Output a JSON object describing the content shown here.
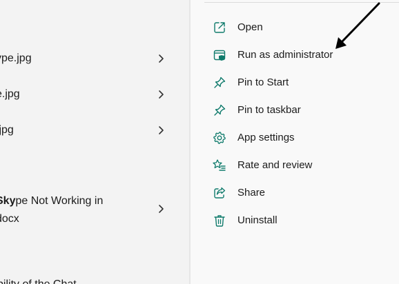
{
  "accent_color": "#0e7a6b",
  "results": [
    {
      "text_bold": "",
      "text": "ype.jpg",
      "chevron_icon": "chevron-right-icon"
    },
    {
      "text_bold": "",
      "text": "e.jpg",
      "chevron_icon": "chevron-right-icon"
    },
    {
      "text_bold": "",
      "text": ".jpg",
      "chevron_icon": "chevron-right-icon"
    },
    {
      "text_bold": "Sky",
      "text": "pe Not Working in",
      "text2": "docx",
      "chevron_icon": "chevron-right-icon"
    }
  ],
  "cut_text": "bility of the Chat",
  "context_menu": {
    "items": [
      {
        "label": "Open",
        "icon": "open-icon"
      },
      {
        "label": "Run as administrator",
        "icon": "run-as-admin-icon"
      },
      {
        "label": "Pin to Start",
        "icon": "pin-icon"
      },
      {
        "label": "Pin to taskbar",
        "icon": "pin-icon"
      },
      {
        "label": "App settings",
        "icon": "gear-icon"
      },
      {
        "label": "Rate and review",
        "icon": "star-list-icon"
      },
      {
        "label": "Share",
        "icon": "share-icon"
      },
      {
        "label": "Uninstall",
        "icon": "trash-icon"
      }
    ]
  },
  "annotation": {
    "type": "arrow",
    "points_to": "Run as administrator",
    "color": "#000000"
  }
}
